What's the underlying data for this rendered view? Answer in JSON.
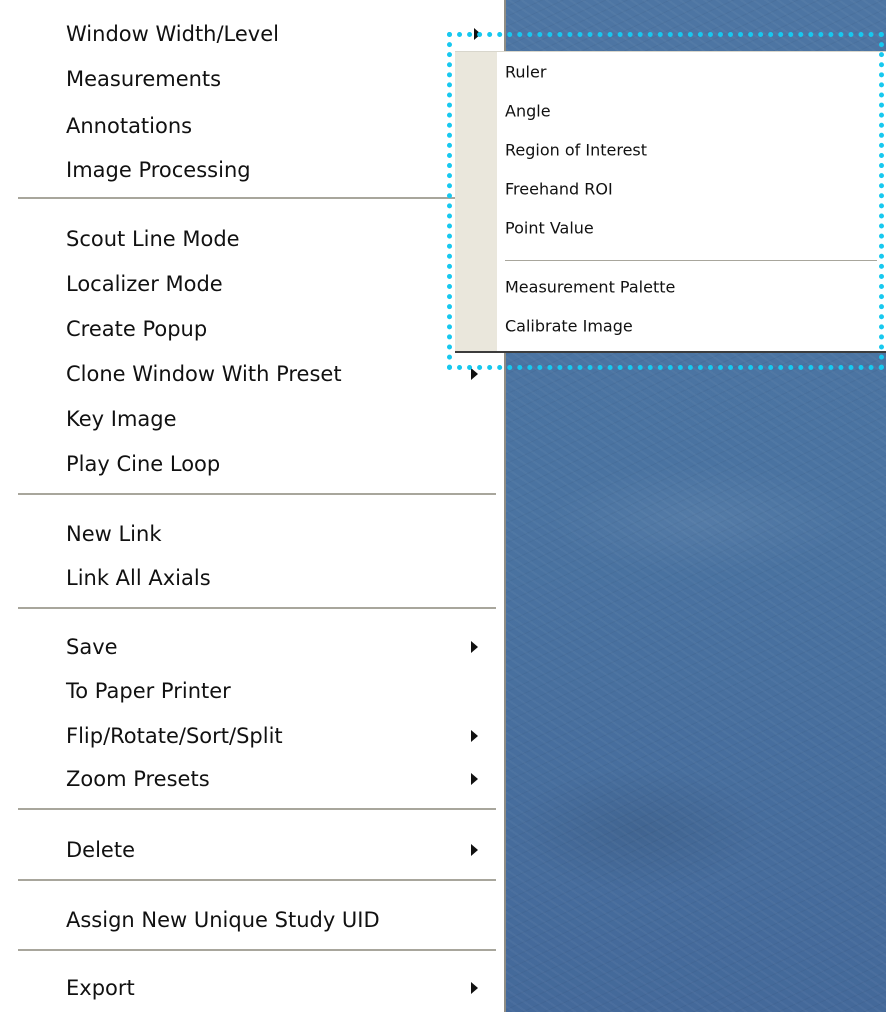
{
  "context_menu": {
    "items": [
      {
        "label": "Window Width/Level",
        "submenu": true
      },
      {
        "label": "Measurements",
        "submenu": false
      },
      {
        "label": "Annotations",
        "submenu": false
      },
      {
        "label": "Image Processing",
        "submenu": false
      },
      {
        "label": "Scout Line Mode",
        "submenu": false
      },
      {
        "label": "Localizer Mode",
        "submenu": false
      },
      {
        "label": "Create Popup",
        "submenu": false
      },
      {
        "label": "Clone Window With Preset",
        "submenu": true
      },
      {
        "label": "Key Image",
        "submenu": false
      },
      {
        "label": "Play Cine Loop",
        "submenu": false
      },
      {
        "label": "New Link",
        "submenu": false
      },
      {
        "label": "Link All Axials",
        "submenu": false
      },
      {
        "label": "Save",
        "submenu": true
      },
      {
        "label": "To Paper Printer",
        "submenu": false
      },
      {
        "label": "Flip/Rotate/Sort/Split",
        "submenu": true
      },
      {
        "label": "Zoom Presets",
        "submenu": true
      },
      {
        "label": "Delete",
        "submenu": true
      },
      {
        "label": "Assign New Unique Study UID",
        "submenu": false
      },
      {
        "label": "Export",
        "submenu": true
      }
    ]
  },
  "measurements_submenu": {
    "items": [
      {
        "label": "Ruler"
      },
      {
        "label": "Angle"
      },
      {
        "label": "Region of Interest"
      },
      {
        "label": "Freehand ROI"
      },
      {
        "label": "Point Value"
      },
      {
        "label": "Measurement Palette"
      },
      {
        "label": "Calibrate Image"
      }
    ]
  },
  "colors": {
    "background": "#4a73a1",
    "menu_background": "#ffffff",
    "submenu_gutter": "#eae7dc",
    "highlight_border": "#17c8ef"
  }
}
